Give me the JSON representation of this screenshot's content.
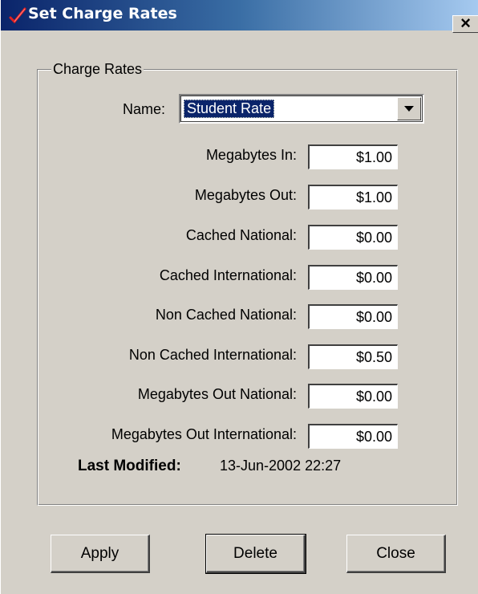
{
  "window": {
    "title": "Set Charge Rates",
    "close_label": "×"
  },
  "group": {
    "legend": "Charge Rates"
  },
  "name_field": {
    "label": "Name:",
    "value": "Student Rate"
  },
  "rates": [
    {
      "label": "Megabytes In:",
      "value": "$1.00"
    },
    {
      "label": "Megabytes Out:",
      "value": "$1.00"
    },
    {
      "label": "Cached National:",
      "value": "$0.00"
    },
    {
      "label": "Cached International:",
      "value": "$0.00"
    },
    {
      "label": "Non Cached National:",
      "value": "$0.00"
    },
    {
      "label": "Non Cached International:",
      "value": "$0.50"
    },
    {
      "label": "Megabytes Out National:",
      "value": "$0.00"
    },
    {
      "label": "Megabytes Out International:",
      "value": "$0.00"
    }
  ],
  "last_modified": {
    "label": "Last Modified:",
    "value": "13-Jun-2002 22:27"
  },
  "buttons": {
    "apply": "Apply",
    "delete": "Delete",
    "close": "Close"
  },
  "icons": {
    "app": "checkmark-icon",
    "close": "close-icon",
    "dropdown": "chevron-down-icon"
  }
}
